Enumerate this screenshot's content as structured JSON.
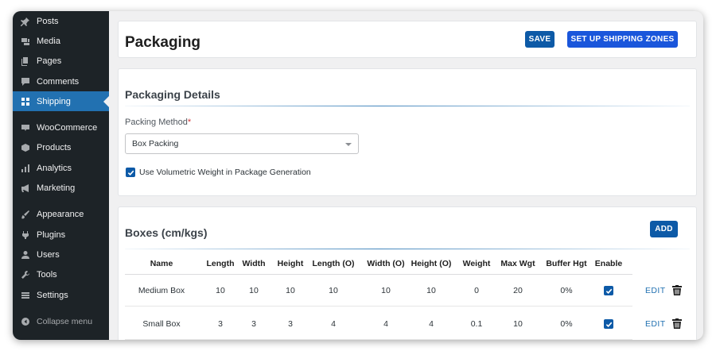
{
  "sidebar": {
    "items": [
      {
        "label": "Posts",
        "icon": "pin-icon"
      },
      {
        "label": "Media",
        "icon": "media-icon"
      },
      {
        "label": "Pages",
        "icon": "pages-icon"
      },
      {
        "label": "Comments",
        "icon": "comments-icon"
      },
      {
        "label": "Shipping",
        "icon": "grid-icon",
        "active": true
      },
      {
        "label": "WooCommerce",
        "icon": "woo-icon"
      },
      {
        "label": "Products",
        "icon": "box-icon"
      },
      {
        "label": "Analytics",
        "icon": "bar-chart-icon"
      },
      {
        "label": "Marketing",
        "icon": "megaphone-icon"
      },
      {
        "label": "Appearance",
        "icon": "brush-icon"
      },
      {
        "label": "Plugins",
        "icon": "plug-icon"
      },
      {
        "label": "Users",
        "icon": "user-icon"
      },
      {
        "label": "Tools",
        "icon": "wrench-icon"
      },
      {
        "label": "Settings",
        "icon": "settings-icon"
      },
      {
        "label": "Collapse menu",
        "icon": "collapse-icon"
      }
    ]
  },
  "header": {
    "title": "Packaging",
    "save_label": "SAVE",
    "zones_label": "SET UP SHIPPING ZONES"
  },
  "details": {
    "title": "Packaging Details",
    "packing_method_label": "Packing Method",
    "required_mark": "*",
    "packing_method_value": "Box Packing",
    "volumetric_label": "Use Volumetric Weight in Package Generation",
    "volumetric_checked": true
  },
  "boxes": {
    "title": "Boxes (cm/kgs)",
    "add_label": "ADD",
    "edit_label": "EDIT",
    "columns": [
      "Name",
      "Length",
      "Width",
      "Height",
      "Length (O)",
      "Width (O)",
      "Height (O)",
      "Weight",
      "Max Wgt",
      "Buffer Hgt",
      "Enable"
    ],
    "rows": [
      [
        "Medium Box",
        "10",
        "10",
        "10",
        "10",
        "10",
        "10",
        "0",
        "20",
        "0%"
      ],
      [
        "Small Box",
        "3",
        "3",
        "3",
        "4",
        "4",
        "4",
        "0.1",
        "10",
        "0%"
      ]
    ]
  },
  "colors": {
    "sidebar_bg": "#1d2327",
    "active_item": "#2271b1",
    "primary_button": "#0d5aa7",
    "zones_button": "#1a56db",
    "link": "#2271b1"
  }
}
